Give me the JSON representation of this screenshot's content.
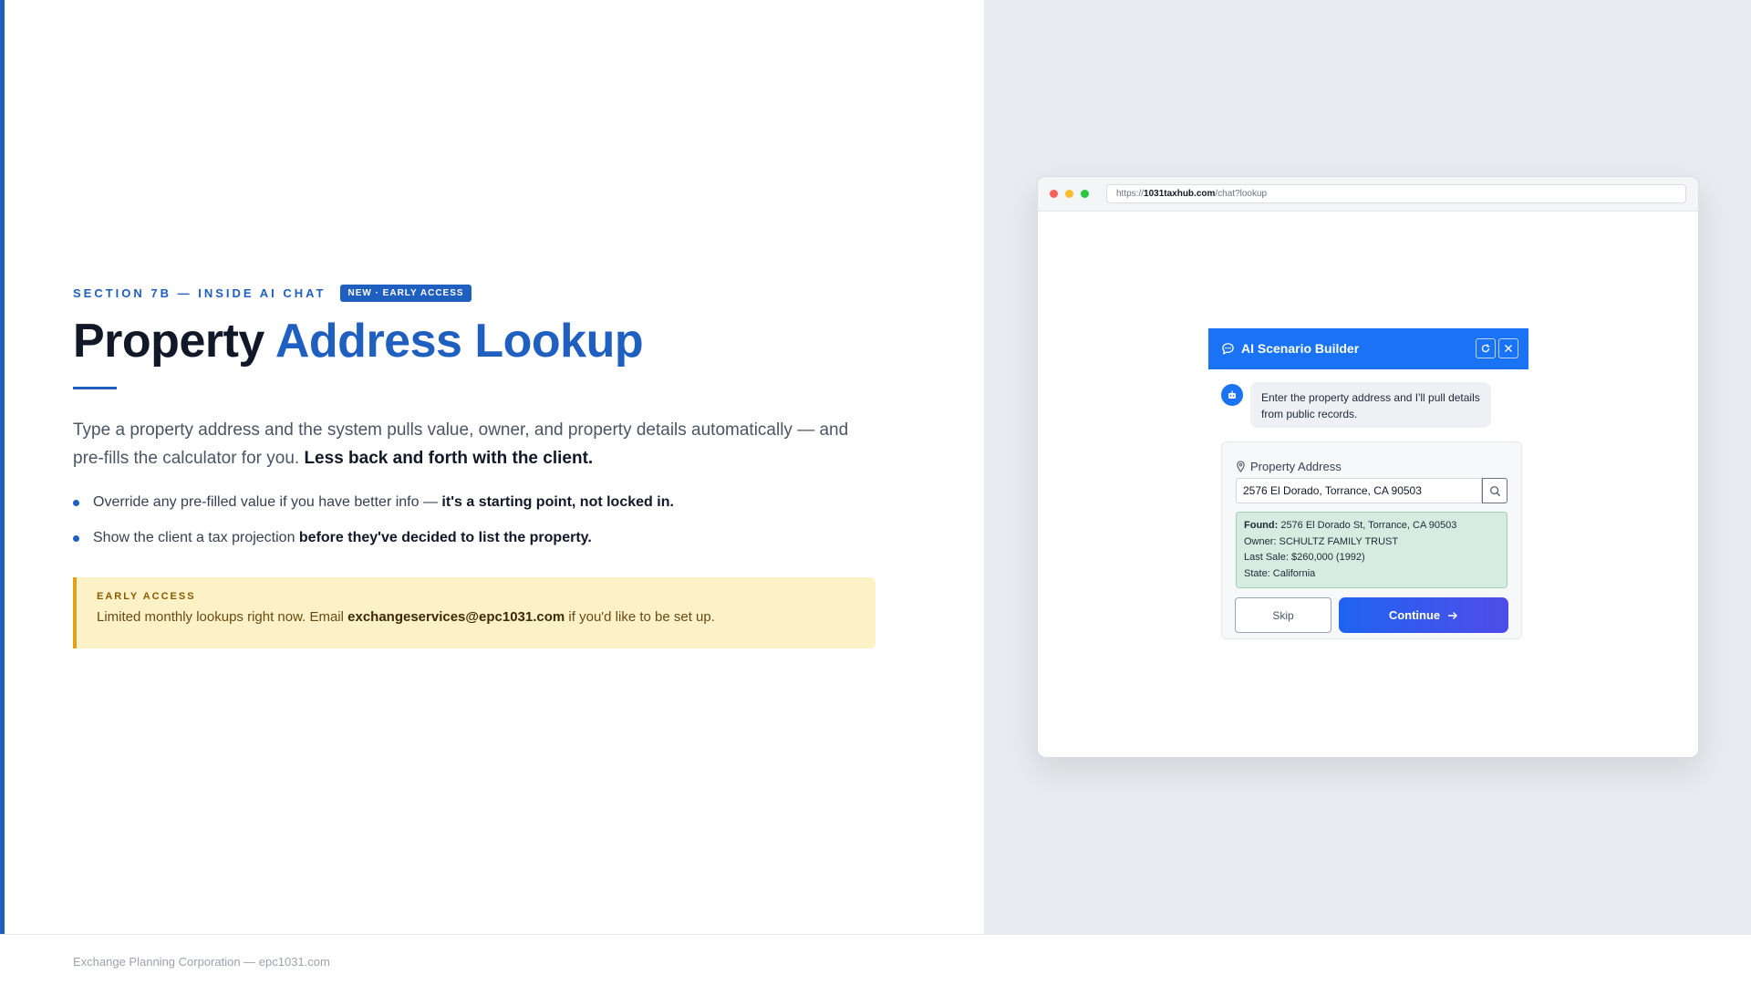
{
  "eyebrow": "SECTION 7B — INSIDE AI CHAT",
  "badge": "NEW · EARLY ACCESS",
  "title": {
    "part1": "Property ",
    "part2": "Address Lookup"
  },
  "lead": {
    "text": "Type a property address and the system pulls value, owner, and property details automatically — and pre-fills the calculator for you. ",
    "strong": "Less back and forth with the client."
  },
  "bullets": [
    {
      "text": "Override any pre-filled value if you have better info — ",
      "strong": "it's a starting point, not locked in."
    },
    {
      "text": "Show the client a tax projection ",
      "strong": "before they've decided to list the property."
    }
  ],
  "callout": {
    "label": "EARLY ACCESS",
    "prefix": "Limited monthly lookups right now. Email ",
    "email": "exchangeservices@epc1031.com",
    "suffix": " if you'd like to be set up."
  },
  "browser": {
    "url_scheme": "https://",
    "url_domain": "1031taxhub.com",
    "url_path": "/chat?lookup"
  },
  "chat": {
    "title": "AI Scenario Builder",
    "bot_message": "Enter the property address and I'll pull details from public records.",
    "field_label": "Property Address",
    "address_value": "2576 El Dorado, Torrance, CA 90503",
    "result": {
      "found_label": "Found:",
      "found_value": " 2576 El Dorado St, Torrance, CA 90503",
      "owner": "Owner: SCHULTZ FAMILY TRUST",
      "last_sale": "Last Sale: $260,000 (1992)",
      "state": "State: California"
    },
    "skip_label": "Skip",
    "continue_label": "Continue"
  },
  "footer": "Exchange Planning Corporation — epc1031.com",
  "colors": {
    "brand_blue": "#1f5fbf",
    "chat_blue": "#1a73f5",
    "callout_bg": "#fdf1c7",
    "callout_border": "#e0a316",
    "result_bg": "#d7ece1"
  }
}
